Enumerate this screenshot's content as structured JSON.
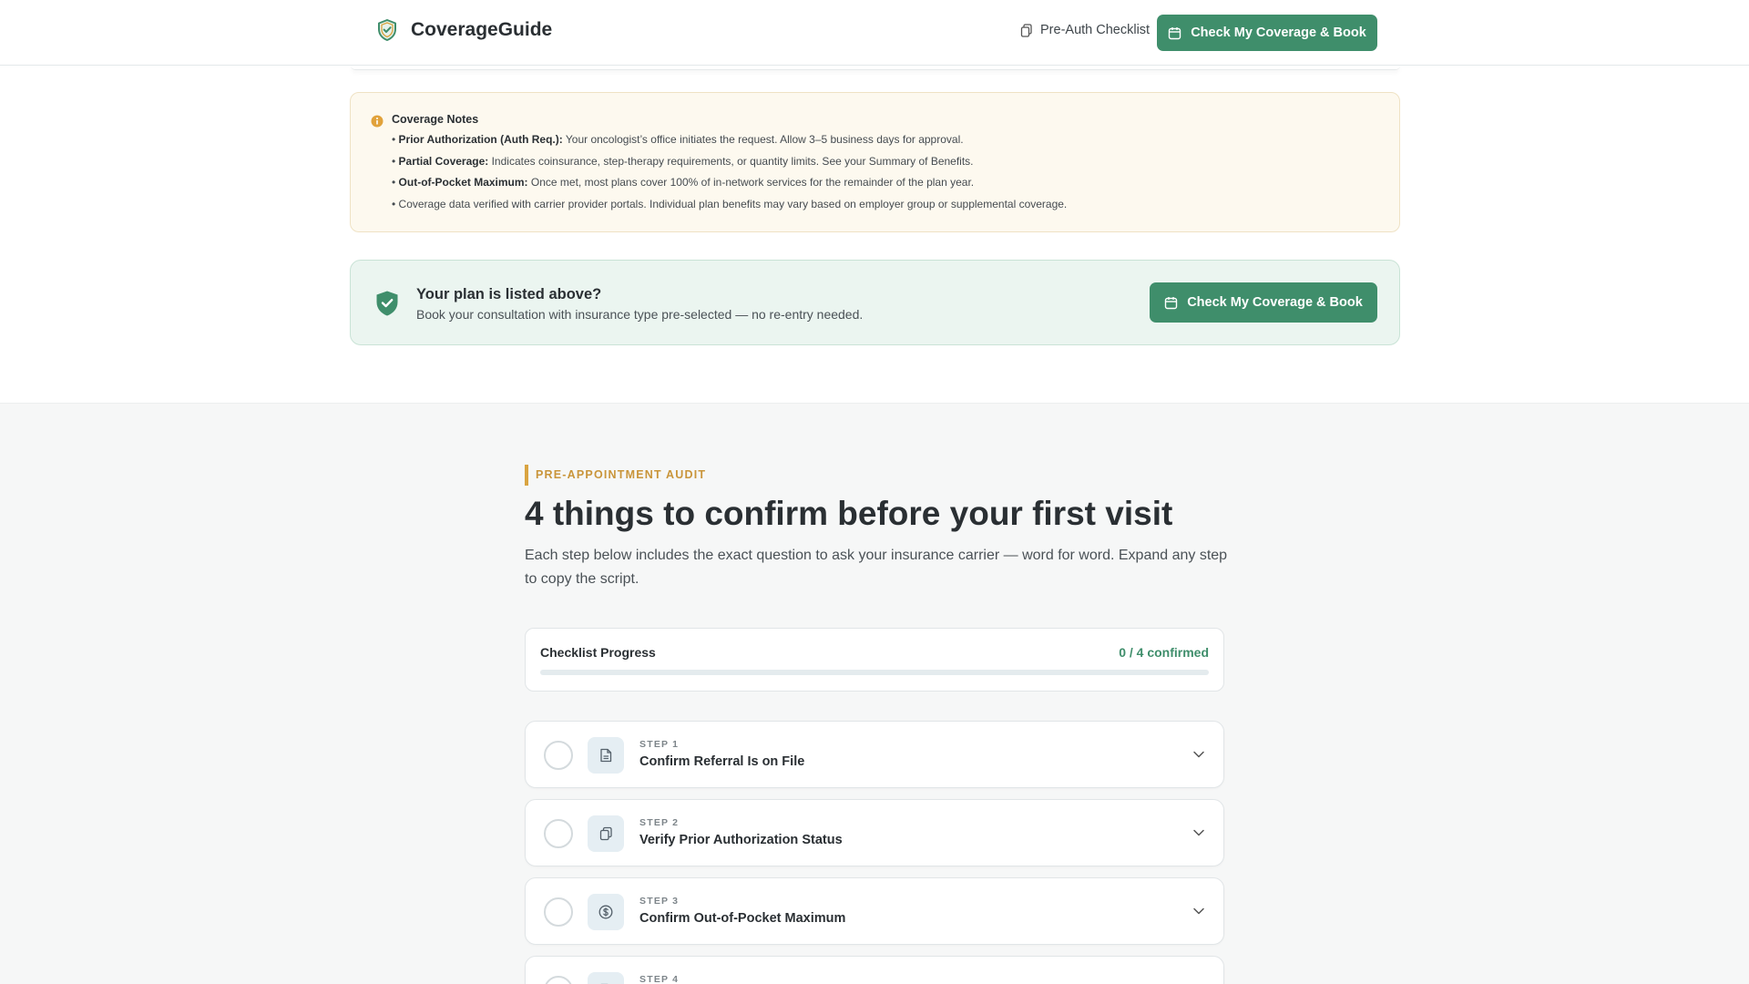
{
  "header": {
    "brand": "CoverageGuide",
    "link_label": "Pre-Auth Checklist",
    "cta_label": "Check My Coverage & Book"
  },
  "notes": {
    "title": "Coverage Notes",
    "items": [
      {
        "bold": "Prior Authorization (Auth Req.):",
        "text": " Your oncologist’s office initiates the request. Allow 3–5 business days for approval."
      },
      {
        "bold": "Partial Coverage:",
        "text": " Indicates coinsurance, step-therapy requirements, or quantity limits. See your Summary of Benefits."
      },
      {
        "bold": "Out-of-Pocket Maximum:",
        "text": " Once met, most plans cover 100% of in-network services for the remainder of the plan year."
      },
      {
        "bold": "",
        "text": "Coverage data verified with carrier provider portals. Individual plan benefits may vary based on employer group or supplemental coverage."
      }
    ]
  },
  "plan_bar": {
    "title": "Your plan is listed above?",
    "subtitle": "Book your consultation with insurance type pre-selected — no re-entry needed.",
    "cta_label": "Check My Coverage & Book"
  },
  "audit": {
    "eyebrow": "PRE-APPOINTMENT AUDIT",
    "headline": "4 things to confirm before your first visit",
    "lede": "Each step below includes the exact question to ask your insurance carrier — word for word. Expand any step to copy the script."
  },
  "progress": {
    "label": "Checklist Progress",
    "count_text": "0 / 4 confirmed",
    "fraction": 0
  },
  "steps": [
    {
      "num": "STEP 1",
      "title": "Confirm Referral Is on File",
      "icon": "document-icon"
    },
    {
      "num": "STEP 2",
      "title": "Verify Prior Authorization Status",
      "icon": "clipboard-copy-icon"
    },
    {
      "num": "STEP 3",
      "title": "Confirm Out-of-Pocket Maximum",
      "icon": "dollar-circle-icon"
    },
    {
      "num": "STEP 4",
      "title": "",
      "icon": "document-icon"
    }
  ],
  "colors": {
    "accent_green": "#3f8e6b",
    "accent_gold": "#d9a441",
    "notes_bg": "#fdf9ef",
    "plan_bg": "#ebf5f0"
  }
}
